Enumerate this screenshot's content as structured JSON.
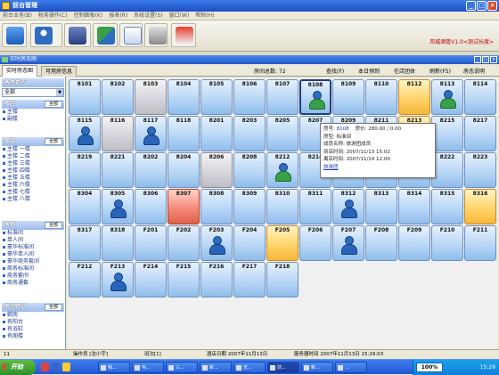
{
  "app": {
    "title": "前台管理",
    "version": "邦威酒管V1.0<测试长度>"
  },
  "menu": [
    "前台业务(B)",
    "帐务操作(C)",
    "控制面板(K)",
    "报表(R)",
    "系统设置(S)",
    "窗口(W)",
    "帮助(H)"
  ],
  "subwindow_title": "实时房态图",
  "tabs": [
    {
      "label": "实时房态图",
      "active": true
    },
    {
      "label": "可用房信息",
      "active": false
    }
  ],
  "room_count_label": "房间总数: 72",
  "actions": [
    "查找(F)",
    "本日预到",
    "在店团体",
    "刷新(F5)",
    "房态说明"
  ],
  "sidebar": {
    "status_head": "客房状态",
    "status_value": "全部",
    "building_head": "楼区",
    "all_label": "全部",
    "buildings": [
      "主楼",
      "副楼"
    ],
    "floor_head": "楼层",
    "floors": [
      "主楼 一楼",
      "主楼 二楼",
      "主楼 三楼",
      "主楼 四楼",
      "主楼 五楼",
      "主楼 六楼",
      "主楼 七楼",
      "主楼 八楼"
    ],
    "type_head": "房类",
    "types": [
      "标准间",
      "单人间",
      "豪华标准间",
      "豪华单人间",
      "豪华商务套间",
      "商务标准间",
      "商务套间",
      "商务通套"
    ],
    "feature_head": "房间特征",
    "features": [
      "朝南",
      "有阳台",
      "有浴缸",
      "有阁楼"
    ]
  },
  "rooms": [
    {
      "no": "8101",
      "state": "blue",
      "occ": ""
    },
    {
      "no": "8102",
      "state": "blue",
      "occ": ""
    },
    {
      "no": "8103",
      "state": "gray",
      "occ": ""
    },
    {
      "no": "8104",
      "state": "blue",
      "occ": ""
    },
    {
      "no": "8105",
      "state": "blue",
      "occ": ""
    },
    {
      "no": "8106",
      "state": "blue",
      "occ": ""
    },
    {
      "no": "8107",
      "state": "blue",
      "occ": ""
    },
    {
      "no": "8108",
      "state": "sel",
      "occ": "group"
    },
    {
      "no": "8109",
      "state": "blue",
      "occ": ""
    },
    {
      "no": "8110",
      "state": "blue",
      "occ": ""
    },
    {
      "no": "8112",
      "state": "orange",
      "occ": ""
    },
    {
      "no": "8113",
      "state": "blue",
      "occ": "group"
    },
    {
      "no": "8114",
      "state": "blue",
      "occ": ""
    },
    {
      "no": "8115",
      "state": "blue",
      "occ": "single"
    },
    {
      "no": "8116",
      "state": "gray",
      "occ": ""
    },
    {
      "no": "8117",
      "state": "blue",
      "occ": "single"
    },
    {
      "no": "8118",
      "state": "blue",
      "occ": ""
    },
    {
      "no": "8201",
      "state": "blue",
      "occ": ""
    },
    {
      "no": "8203",
      "state": "blue",
      "occ": ""
    },
    {
      "no": "8205",
      "state": "blue",
      "occ": ""
    },
    {
      "no": "8207",
      "state": "blue",
      "occ": ""
    },
    {
      "no": "8209",
      "state": "blue",
      "occ": ""
    },
    {
      "no": "8211",
      "state": "blue",
      "occ": ""
    },
    {
      "no": "8213",
      "state": "orange",
      "occ": ""
    },
    {
      "no": "8215",
      "state": "blue",
      "occ": ""
    },
    {
      "no": "8217",
      "state": "blue",
      "occ": ""
    },
    {
      "no": "8219",
      "state": "blue",
      "occ": ""
    },
    {
      "no": "8221",
      "state": "blue",
      "occ": ""
    },
    {
      "no": "8202",
      "state": "blue",
      "occ": ""
    },
    {
      "no": "8204",
      "state": "blue",
      "occ": ""
    },
    {
      "no": "8206",
      "state": "gray",
      "occ": ""
    },
    {
      "no": "8208",
      "state": "blue",
      "occ": ""
    },
    {
      "no": "8212",
      "state": "blue",
      "occ": "group"
    },
    {
      "no": "8214",
      "state": "blue",
      "occ": ""
    },
    {
      "no": "8216",
      "state": "blue",
      "occ": ""
    },
    {
      "no": "8218",
      "state": "blue",
      "occ": ""
    },
    {
      "no": "8220",
      "state": "blue",
      "occ": ""
    },
    {
      "no": "8222",
      "state": "blue",
      "occ": ""
    },
    {
      "no": "8223",
      "state": "blue",
      "occ": ""
    },
    {
      "no": "8304",
      "state": "blue",
      "occ": ""
    },
    {
      "no": "8305",
      "state": "blue",
      "occ": "single"
    },
    {
      "no": "8306",
      "state": "blue",
      "occ": ""
    },
    {
      "no": "8307",
      "state": "red",
      "occ": ""
    },
    {
      "no": "8308",
      "state": "blue",
      "occ": ""
    },
    {
      "no": "8309",
      "state": "blue",
      "occ": ""
    },
    {
      "no": "8310",
      "state": "blue",
      "occ": ""
    },
    {
      "no": "8311",
      "state": "blue",
      "occ": ""
    },
    {
      "no": "8312",
      "state": "blue",
      "occ": "single"
    },
    {
      "no": "8313",
      "state": "blue",
      "occ": ""
    },
    {
      "no": "8314",
      "state": "blue",
      "occ": ""
    },
    {
      "no": "8315",
      "state": "blue",
      "occ": ""
    },
    {
      "no": "8316",
      "state": "orange",
      "occ": ""
    },
    {
      "no": "8317",
      "state": "blue",
      "occ": ""
    },
    {
      "no": "8318",
      "state": "blue",
      "occ": ""
    },
    {
      "no": "F201",
      "state": "blue",
      "occ": ""
    },
    {
      "no": "F202",
      "state": "blue",
      "occ": ""
    },
    {
      "no": "F203",
      "state": "blue",
      "occ": "single"
    },
    {
      "no": "F204",
      "state": "blue",
      "occ": ""
    },
    {
      "no": "F205",
      "state": "orange",
      "occ": ""
    },
    {
      "no": "F206",
      "state": "blue",
      "occ": ""
    },
    {
      "no": "F207",
      "state": "blue",
      "occ": "single"
    },
    {
      "no": "F208",
      "state": "blue",
      "occ": ""
    },
    {
      "no": "F209",
      "state": "blue",
      "occ": ""
    },
    {
      "no": "F210",
      "state": "blue",
      "occ": ""
    },
    {
      "no": "F211",
      "state": "blue",
      "occ": ""
    },
    {
      "no": "F212",
      "state": "blue",
      "occ": ""
    },
    {
      "no": "F213",
      "state": "blue",
      "occ": "single"
    },
    {
      "no": "F214",
      "state": "blue",
      "occ": ""
    },
    {
      "no": "F215",
      "state": "blue",
      "occ": ""
    },
    {
      "no": "F216",
      "state": "blue",
      "occ": ""
    },
    {
      "no": "F217",
      "state": "blue",
      "occ": ""
    },
    {
      "no": "F218",
      "state": "blue",
      "occ": ""
    }
  ],
  "popup": {
    "room_label": "房号:",
    "room_value": "8108",
    "price_label": "房价:",
    "price_value": "280.00",
    "price_sep": "/",
    "price_extra": "0.00",
    "type_label": "房型:",
    "type_value": "标准间",
    "guest_label": "成员名称:",
    "guest_value": "旅游团成员",
    "arrive_label": "到店时间:",
    "arrive_value": "2007/11/13 15:02",
    "depart_label": "离店时间:",
    "depart_value": "2007/11/14 12:00",
    "link": "旅游团"
  },
  "status_bar": {
    "no": "11",
    "operator": "操作员 [沈小宇]",
    "shift": "班次[1]",
    "hotel_date": "酒店日期  2007年11月13日",
    "server_time": "服务器时间  2007年11月13日  15:29:03"
  },
  "taskbar": {
    "start": "开始",
    "tasks": [
      "我...",
      "毛...",
      "三...",
      "新...",
      "无...",
      "前...",
      "新...",
      "..."
    ],
    "zoom": "100%",
    "clock": "15:29"
  }
}
